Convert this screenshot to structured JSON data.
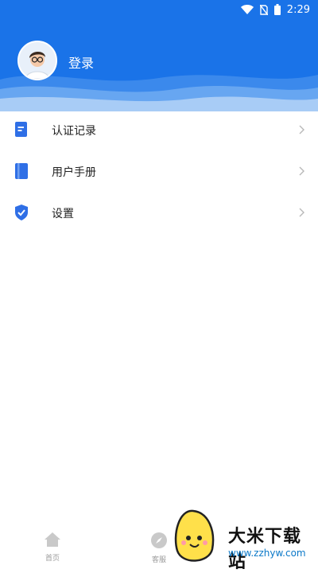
{
  "statusbar": {
    "time": "2:29",
    "icons": [
      "wifi-icon",
      "no-sim-icon",
      "battery-icon"
    ]
  },
  "header": {
    "login_label": "登录",
    "background": "#1a73e8"
  },
  "menu": {
    "items": [
      {
        "label": "认证记录",
        "icon": "document-list-icon"
      },
      {
        "label": "用户手册",
        "icon": "book-icon"
      },
      {
        "label": "设置",
        "icon": "shield-check-icon"
      }
    ]
  },
  "tabbar": {
    "tabs": [
      {
        "label": "首页",
        "icon": "home-icon"
      },
      {
        "label": "客服",
        "icon": "compass-icon"
      }
    ]
  },
  "watermark": {
    "title": "大米下载站",
    "url": "www.zzhyw.com"
  }
}
